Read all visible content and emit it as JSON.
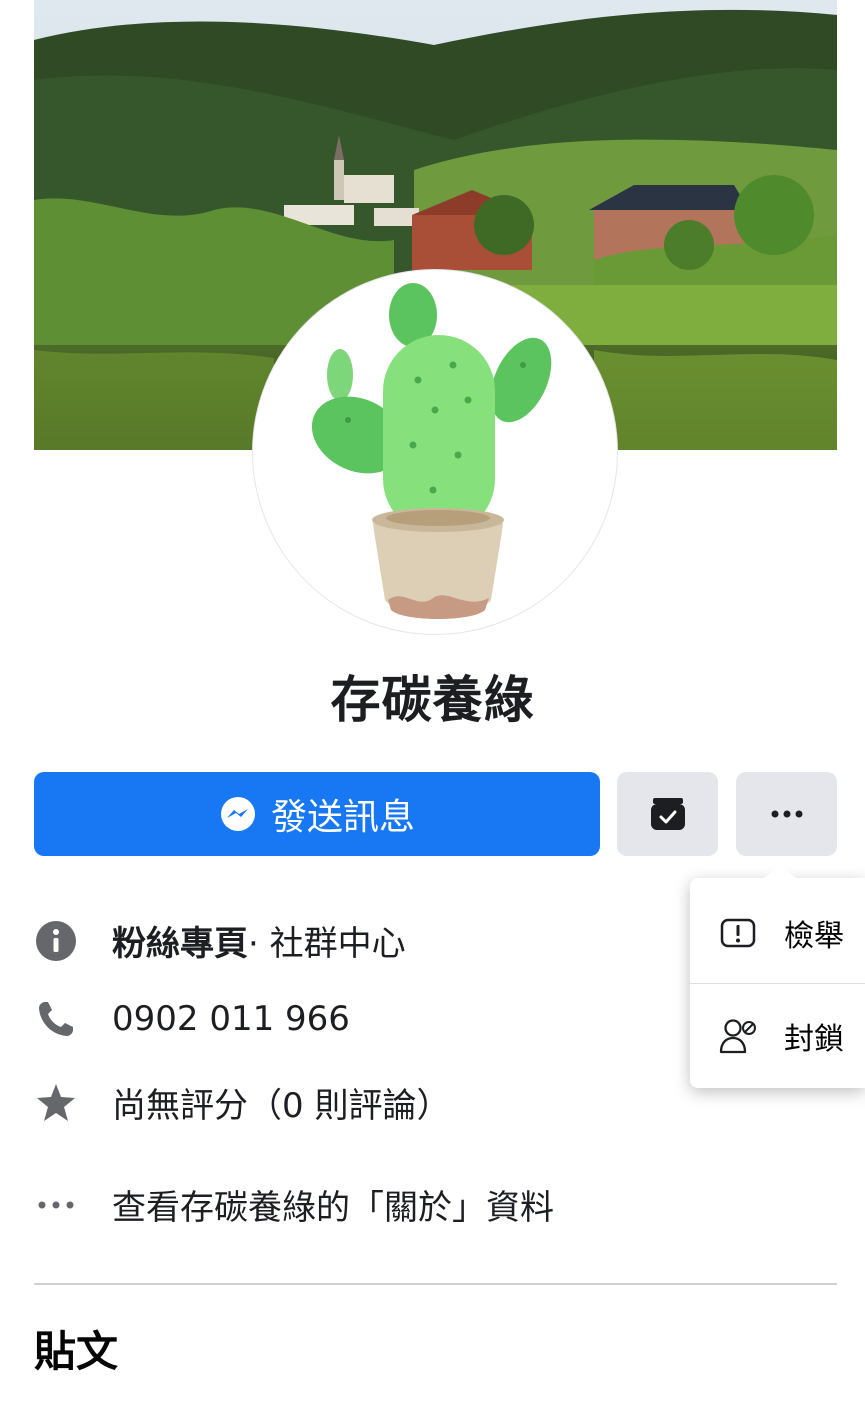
{
  "page": {
    "name": "存碳養綠"
  },
  "actions": {
    "message_label": "發送訊息",
    "icons": {
      "message": "messenger-icon",
      "inbox": "inbox-check-icon",
      "more": "more-dots-icon"
    }
  },
  "info": {
    "category_type": "粉絲專頁",
    "category_detail": " · 社群中心",
    "phone": "0902 011 966",
    "rating": "尚無評分（0 則評論）",
    "about_link": "查看存碳養綠的「關於」資料"
  },
  "menu": {
    "items": [
      {
        "label": "檢舉",
        "icon": "report-icon"
      },
      {
        "label": "封鎖",
        "icon": "block-user-icon"
      }
    ]
  },
  "posts": {
    "title": "貼文"
  },
  "colors": {
    "primary": "#1877f2",
    "secondary_button": "#e4e6eb",
    "icon_gray": "#65676b"
  }
}
